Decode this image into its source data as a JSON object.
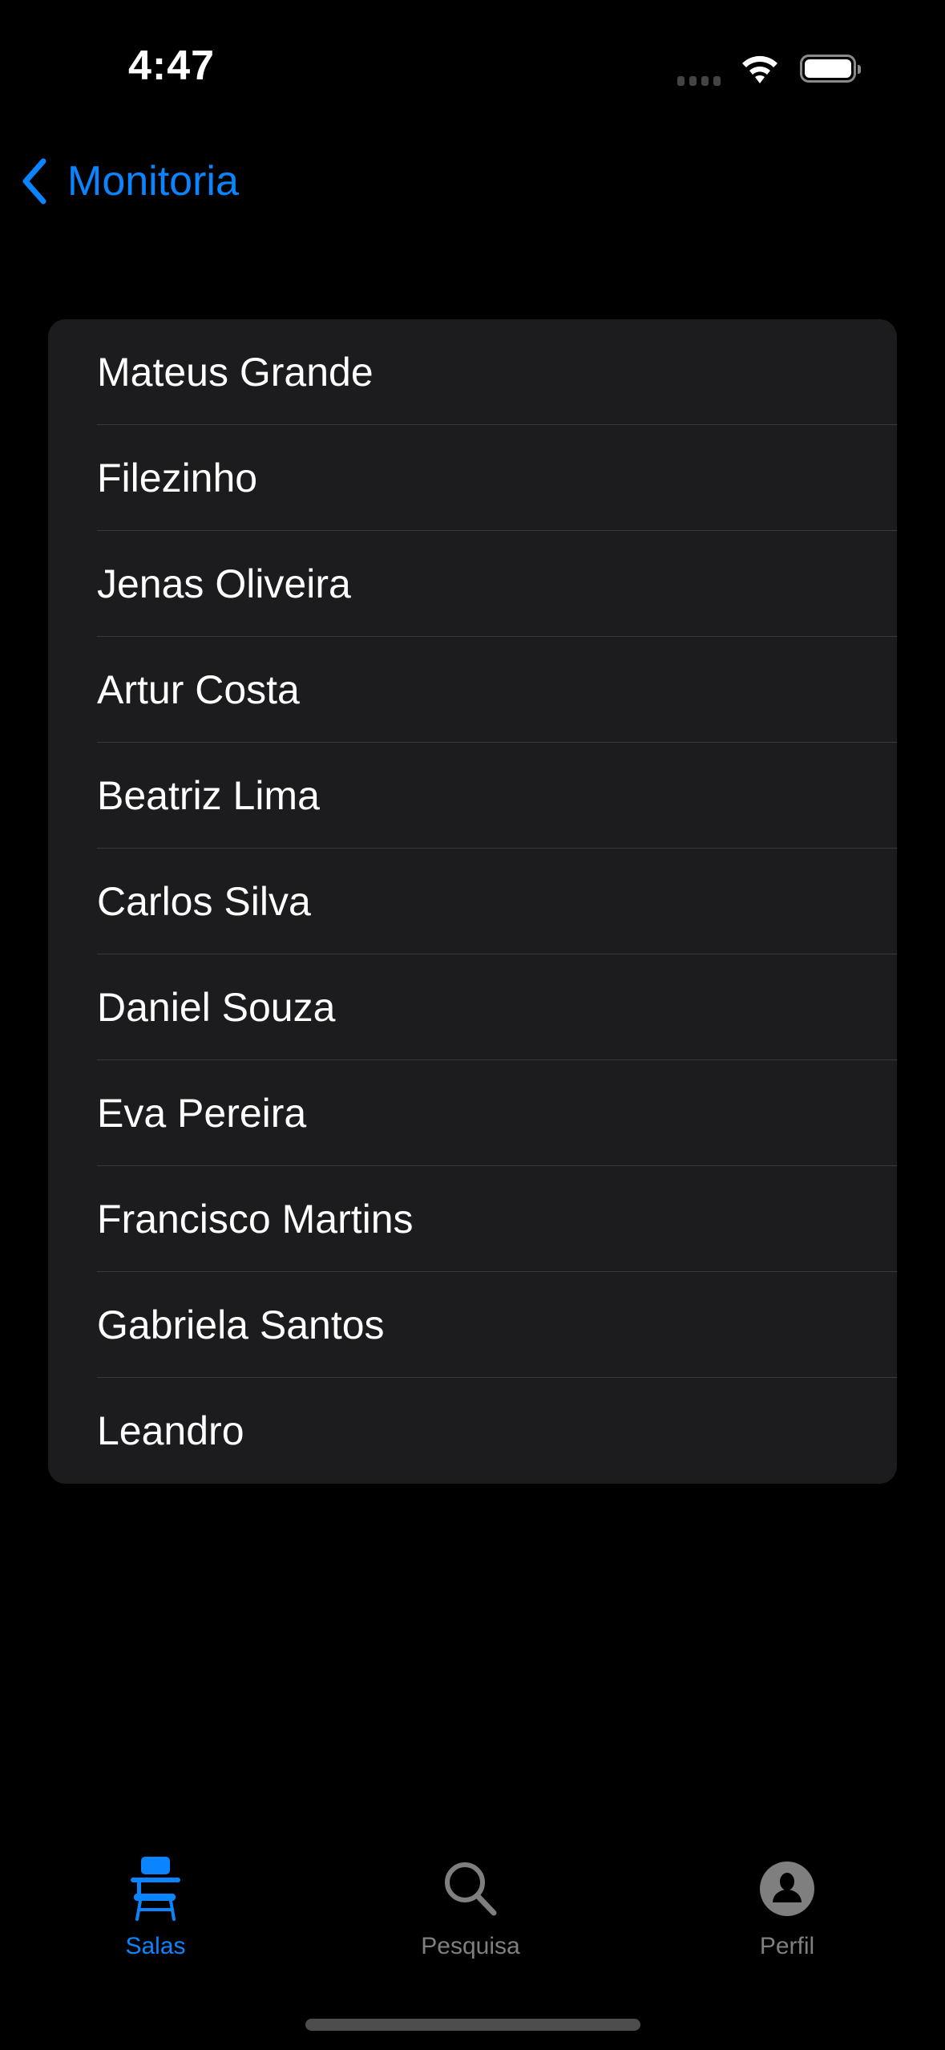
{
  "status_bar": {
    "time": "4:47"
  },
  "nav": {
    "back_label": "Monitoria"
  },
  "list": {
    "items": [
      "Mateus Grande",
      "Filezinho",
      "Jenas Oliveira",
      "Artur Costa",
      "Beatriz Lima",
      "Carlos Silva",
      "Daniel Souza",
      "Eva Pereira",
      "Francisco Martins",
      "Gabriela Santos",
      "Leandro"
    ]
  },
  "tabs": [
    {
      "label": "Salas",
      "icon": "desk-chair-icon",
      "active": true
    },
    {
      "label": "Pesquisa",
      "icon": "search-icon",
      "active": false
    },
    {
      "label": "Perfil",
      "icon": "person-circle-icon",
      "active": false
    }
  ],
  "colors": {
    "accent": "#0a84ff",
    "inactive": "#7f7f7f",
    "card": "#1c1c1e"
  }
}
